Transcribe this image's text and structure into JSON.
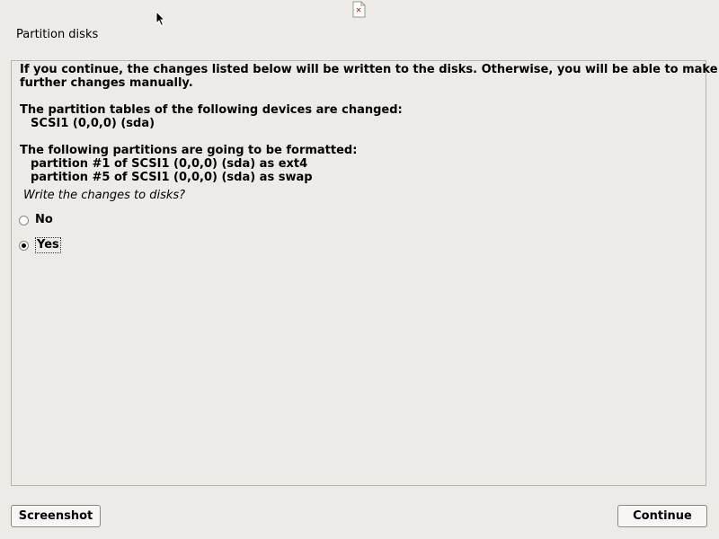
{
  "header": {
    "title": "Partition disks"
  },
  "message": {
    "intro_line1": "If you continue, the changes listed below will be written to the disks. Otherwise, you will be able to make",
    "intro_line2": "further changes manually.",
    "tables_heading": "The partition tables of the following devices are changed:",
    "tables_devices": [
      "SCSI1 (0,0,0) (sda)"
    ],
    "format_heading": "The following partitions are going to be formatted:",
    "format_partitions": [
      "partition #1 of SCSI1 (0,0,0) (sda) as ext4",
      "partition #5 of SCSI1 (0,0,0) (sda) as swap"
    ]
  },
  "question": "Write the changes to disks?",
  "options": [
    {
      "label": "No",
      "selected": false
    },
    {
      "label": "Yes",
      "selected": true
    }
  ],
  "buttons": {
    "screenshot": "Screenshot",
    "continue": "Continue"
  }
}
